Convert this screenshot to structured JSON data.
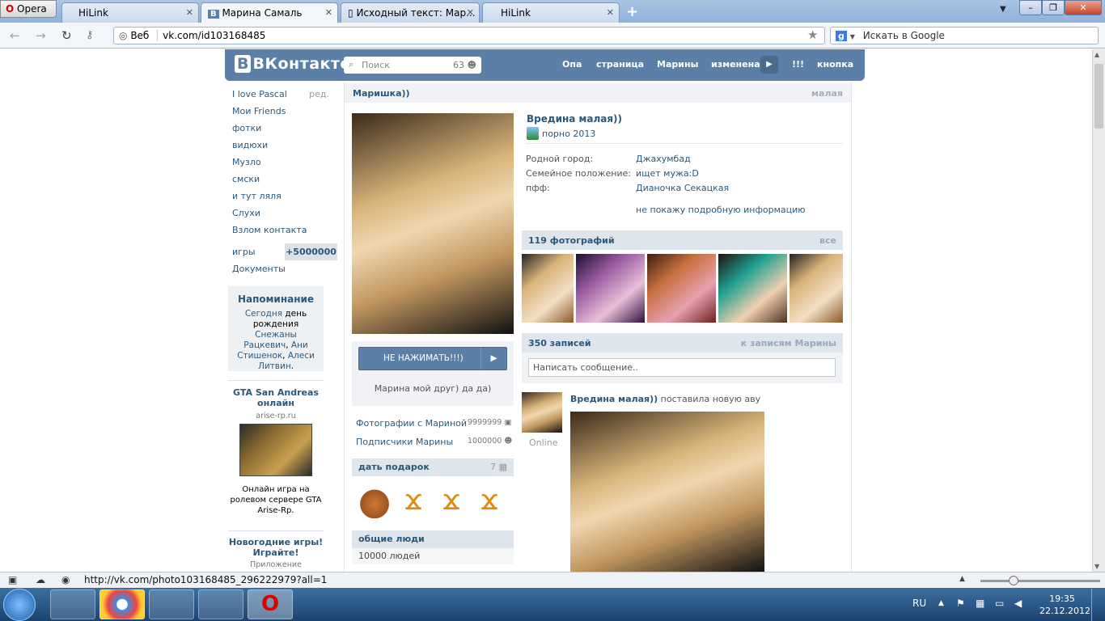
{
  "browser": {
    "opera_label": "Opera",
    "tabs": [
      {
        "title": "HiLink"
      },
      {
        "title": "Марина Самаль"
      },
      {
        "title": "Исходный текст: Мар..."
      },
      {
        "title": "HiLink"
      }
    ],
    "address_scheme": "Веб",
    "address_url": "vk.com/id103168485",
    "search_placeholder": "Искать в Google",
    "status_url": "http://vk.com/photo103168485_296222979?all=1"
  },
  "vk": {
    "logo": "ВКонтакте",
    "search_placeholder": "Поиск",
    "search_count": "63",
    "nav": [
      "Опа",
      "страница",
      "Марины",
      "изменена",
      "!!!",
      "кнопка"
    ],
    "left_menu": [
      {
        "label": "I love Pascal",
        "extra": "ред."
      },
      {
        "label": "Мои Friends"
      },
      {
        "label": "фотки"
      },
      {
        "label": "видюхи"
      },
      {
        "label": "Музло"
      },
      {
        "label": "смски"
      },
      {
        "label": "и тут ляля"
      },
      {
        "label": "Слухи"
      },
      {
        "label": "Взлом контакта"
      },
      {
        "label": "игры",
        "extra": "+5000000"
      },
      {
        "label": "Документы"
      }
    ],
    "reminder": {
      "title": "Напоминание",
      "text_1": "Сегодня",
      "text_2": " день рождения ",
      "text_3": "Снежаны Рацкевич",
      "text_4": ", ",
      "text_5": "Ани Стишенок",
      "text_6": ", ",
      "text_7": "Алеси Литвин",
      "text_8": "."
    },
    "ad1": {
      "title": "GTA San Andreas онлайн",
      "domain": "arise-rp.ru",
      "text": "Онлайн игра на ролевом сервере GTA Arise-Rp."
    },
    "ad2": {
      "title": "Новогодние игры! Играйте!",
      "sub": "Приложение"
    },
    "profile": {
      "header_left": "Маришка))",
      "header_right": "малая",
      "name": "Вредина малая))",
      "status": "порно 2013",
      "info": [
        {
          "label": "Родной город:",
          "value": "Джахумбад"
        },
        {
          "label": "Семейное положение:",
          "value": "ищет мужа:D"
        },
        {
          "label": "пфф:",
          "value": "Дианочка Секацкая"
        }
      ],
      "more": "не покажу подробную информацию",
      "action_button": "НЕ НАЖИМАТЬ!!!)",
      "friend_note": "Марина мой друг) да да)",
      "photos_with": "Фотографии с Мариной",
      "photos_with_count": "9999999",
      "subscribers": "Подписчики Марины",
      "subscribers_count": "1000000",
      "gifts_title": "дать подарок",
      "gifts_count": "7",
      "common_title": "общие люди",
      "common_count": "10000 людей"
    },
    "photos": {
      "title": "119 фотографий",
      "all": "все"
    },
    "wall": {
      "title": "350 записей",
      "link": "к записям Марины",
      "input_placeholder": "Написать сообщение..",
      "post_author": "Вредина малая))",
      "post_action": " поставила новую аву",
      "online": "Online"
    }
  },
  "taskbar": {
    "lang": "RU",
    "time": "19:35",
    "date": "22.12.2012"
  }
}
